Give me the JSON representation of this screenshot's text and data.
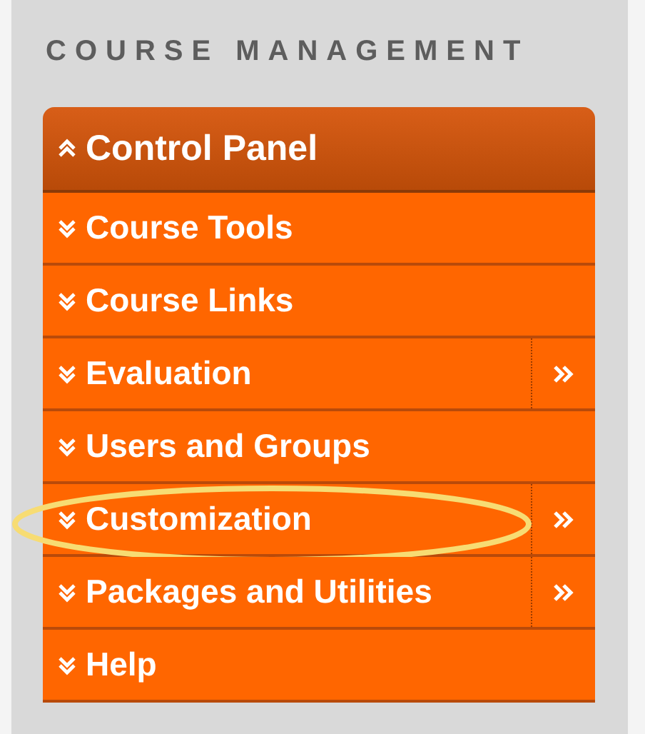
{
  "heading": "COURSE MANAGEMENT",
  "panel": {
    "title": "Control Panel",
    "expanded": true
  },
  "items": [
    {
      "label": "Course Tools",
      "expanded": false,
      "flyout": false,
      "circled": false
    },
    {
      "label": "Course Links",
      "expanded": false,
      "flyout": false,
      "circled": false
    },
    {
      "label": "Evaluation",
      "expanded": false,
      "flyout": true,
      "circled": false
    },
    {
      "label": "Users and Groups",
      "expanded": false,
      "flyout": false,
      "circled": false
    },
    {
      "label": "Customization",
      "expanded": false,
      "flyout": true,
      "circled": true
    },
    {
      "label": "Packages and Utilities",
      "expanded": false,
      "flyout": true,
      "circled": false
    },
    {
      "label": "Help",
      "expanded": false,
      "flyout": false,
      "circled": false
    }
  ]
}
